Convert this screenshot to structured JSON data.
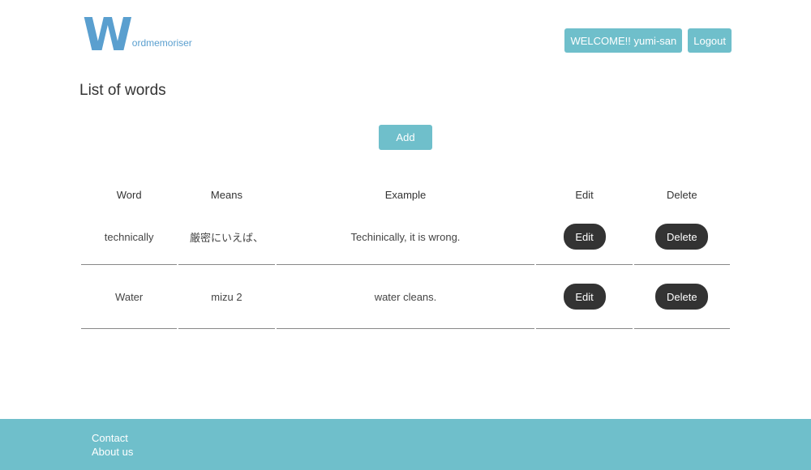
{
  "header": {
    "logo_initial": "W",
    "logo_rest": "ordmemoriser",
    "welcome_label": "WELCOME!! yumi-san",
    "logout_label": "Logout"
  },
  "page": {
    "title": "List of words",
    "add_label": "Add"
  },
  "table": {
    "columns": [
      "Word",
      "Means",
      "Example",
      "Edit",
      "Delete"
    ],
    "rows": [
      {
        "word": "technically",
        "means": "厳密にいえば、",
        "example": "Techinically, it is wrong.",
        "edit_label": "Edit",
        "delete_label": "Delete"
      },
      {
        "word": "Water",
        "means": "mizu 2",
        "example": "water cleans.",
        "edit_label": "Edit",
        "delete_label": "Delete"
      }
    ]
  },
  "footer": {
    "links": [
      "Contact",
      "About us"
    ]
  },
  "colors": {
    "accent": "#6fbfcb",
    "logo": "#5a9fcf",
    "dark_button": "#333333"
  }
}
